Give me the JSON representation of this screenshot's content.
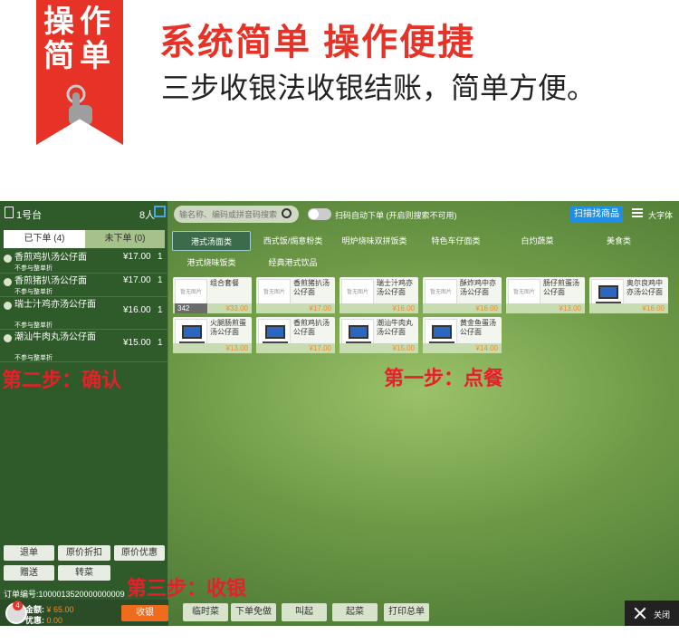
{
  "banner": {
    "badge_line1": "操作",
    "badge_line2": "简单",
    "headline": "系统简单 操作便捷",
    "subline": "三步收银法收银结账，简单方便。"
  },
  "left_panel": {
    "table_no": "1号台",
    "people": "8人",
    "tab_ordered": "已下单 (4)",
    "tab_unordered": "未下单 (0)",
    "orders": [
      {
        "name": "香煎鸡扒汤公仔面",
        "price": "¥17.00",
        "qty": "1",
        "note": "不参与整单折"
      },
      {
        "name": "香煎猪扒汤公仔面",
        "price": "¥17.00",
        "qty": "1",
        "note": "不参与整单折"
      },
      {
        "name": "瑞士汁鸡亦汤公仔面",
        "price": "¥16.00",
        "qty": "1",
        "note": "不参与整单折"
      },
      {
        "name": "潮汕牛肉丸汤公仔面",
        "price": "¥15.00",
        "qty": "1",
        "note": "不参与整单折"
      }
    ],
    "buttons": {
      "refund": "退单",
      "orig_discount": "原价折扣",
      "orig_promo": "原价优惠",
      "gift": "赠送",
      "transfer": "转菜"
    },
    "order_no": "订单编号:1000013520000000009",
    "avatar_badge": "4",
    "amount_label": "金额:",
    "amount_value": "¥ 65.00",
    "discount_label": "优惠:",
    "discount_value": "0.00",
    "checkout": "收银"
  },
  "toolbar": {
    "search_placeholder": "输名称、编码或拼音码搜索",
    "auto_order": "扫码自动下单 (开启则搜索不可用)",
    "scan_btn": "扫描找商品",
    "big_font": "大字体"
  },
  "categories": [
    "港式汤面类",
    "西式饭/焗意粉类",
    "明炉烧味双拼饭类",
    "特色车仔面类",
    "白灼蔬菜",
    "美食类",
    "港式烧味饭类",
    "经典港式饮品"
  ],
  "no_image_text": "暂无图片",
  "products": [
    {
      "name": "组合套餐",
      "price": "¥33.00",
      "stock": "342",
      "image": "none"
    },
    {
      "name": "香煎猪扒汤公仔面",
      "price": "¥17.00",
      "image": "none"
    },
    {
      "name": "瑞士汁鸡亦汤公仔面",
      "price": "¥16.00",
      "image": "none"
    },
    {
      "name": "酥炸鸡中亦汤公仔面",
      "price": "¥16.00",
      "image": "none"
    },
    {
      "name": "肠仔煎蛋汤公仔面",
      "price": "¥13.00",
      "image": "none"
    },
    {
      "name": "奥尔良鸡中亦汤公仔面",
      "price": "¥16.00",
      "image": "pos"
    },
    {
      "name": "火腿肠煎蛋汤公仔面",
      "price": "¥13.00",
      "image": "pos"
    },
    {
      "name": "香煎鸡扒汤公仔面",
      "price": "¥17.00",
      "image": "pos"
    },
    {
      "name": "潮汕牛肉丸汤公仔面",
      "price": "¥15.00",
      "image": "pos"
    },
    {
      "name": "黄金鱼蛋汤公仔面",
      "price": "¥14.00",
      "image": "pos"
    }
  ],
  "steps": {
    "step1": "第一步：点餐",
    "step2": "第二步：确认",
    "step3": "第三步：收银"
  },
  "bottom_actions": [
    "临时菜",
    "下单免做",
    "叫起",
    "起菜",
    "打印总单"
  ],
  "close_label": "关闭",
  "colors": {
    "brand_red": "#e63227",
    "accent_blue": "#1f8ee6",
    "checkout_orange": "#ef6b1d"
  }
}
